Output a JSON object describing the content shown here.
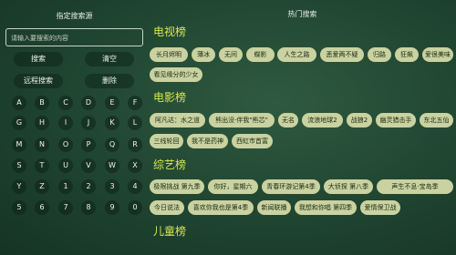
{
  "left": {
    "title": "指定搜索源",
    "search_placeholder": "请输入要搜索的内容",
    "buttons": {
      "search": "搜索",
      "clear": "清空",
      "remote_search": "远程搜索",
      "delete": "删除"
    },
    "keys": [
      "A",
      "B",
      "C",
      "D",
      "E",
      "F",
      "G",
      "H",
      "I",
      "J",
      "K",
      "L",
      "M",
      "N",
      "O",
      "P",
      "Q",
      "R",
      "S",
      "T",
      "U",
      "V",
      "W",
      "X",
      "Y",
      "Z",
      "1",
      "2",
      "3",
      "4",
      "5",
      "6",
      "7",
      "8",
      "9",
      "0"
    ]
  },
  "right": {
    "title": "热门搜索",
    "sections": [
      {
        "title": "电视榜",
        "items": [
          "长月烬明",
          "薄冰",
          "无间",
          "蝶影",
          "人生之路",
          "恶爱两不疑",
          "归路",
          "狂飙",
          "爱很美味",
          "看见缘分的少女"
        ]
      },
      {
        "title": "电影榜",
        "items": [
          "阿凡达：水之道",
          "熊出没·伴我\"熊芯\"",
          "无名",
          "流浪地球2",
          "战狼2",
          "幽灵猎击手",
          "东北五仙",
          "三线轮回",
          "我不是药神",
          "西虹市首富"
        ]
      },
      {
        "title": "综艺榜",
        "items": [
          "极限挑战 第九季",
          "你好，星期六",
          "青春环游记第4季",
          "大侦探 第八季",
          "声生不息·宝岛季",
          "今日说法",
          "喜欢你我也是第4季",
          "新闻联播",
          "我想和你唱 第四季",
          "爱情保卫战"
        ]
      },
      {
        "title": "儿童榜",
        "items": []
      }
    ]
  }
}
